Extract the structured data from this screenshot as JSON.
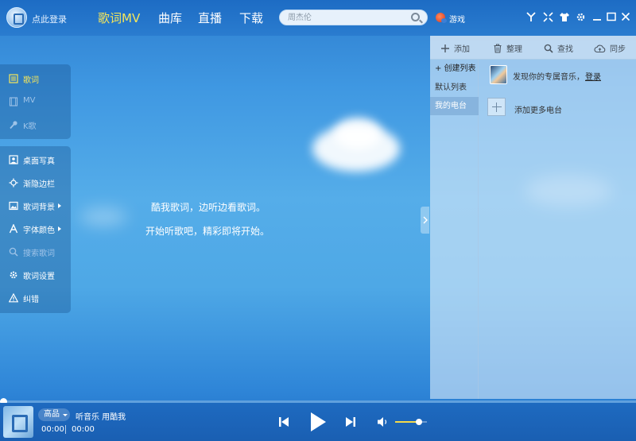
{
  "header": {
    "login": "点此登录",
    "tabs": [
      {
        "label": "歌词MV",
        "active": true
      },
      {
        "label": "曲库",
        "active": false
      },
      {
        "label": "直播",
        "active": false
      },
      {
        "label": "下载",
        "active": false
      }
    ],
    "search_placeholder": "周杰伦",
    "game_label": "游戏",
    "window_controls": [
      "antenna-icon",
      "compact-mode-icon",
      "skin-shirt-icon",
      "settings-gear-icon",
      "minimize-icon",
      "maximize-icon",
      "close-icon"
    ]
  },
  "side_menu_top": [
    {
      "label": "歌词",
      "icon": "lyrics-icon",
      "state": "active"
    },
    {
      "label": "MV",
      "icon": "mv-film-icon",
      "state": "disabled"
    },
    {
      "label": "K歌",
      "icon": "microphone-icon",
      "state": "disabled"
    }
  ],
  "side_menu_bottom": [
    {
      "label": "桌面写真",
      "icon": "desktop-photo-icon",
      "state": "normal",
      "submenu": false
    },
    {
      "label": "渐隐边栏",
      "icon": "fade-sidebar-icon",
      "state": "normal",
      "submenu": false
    },
    {
      "label": "歌词背景",
      "icon": "image-icon",
      "state": "normal",
      "submenu": true
    },
    {
      "label": "字体颜色",
      "icon": "font-icon",
      "state": "normal",
      "submenu": true
    },
    {
      "label": "搜索歌词",
      "icon": "search-icon",
      "state": "disabled",
      "submenu": false
    },
    {
      "label": "歌词设置",
      "icon": "gear-icon",
      "state": "normal",
      "submenu": false
    },
    {
      "label": "纠错",
      "icon": "warning-icon",
      "state": "normal",
      "submenu": false
    }
  ],
  "center": {
    "line1": "酷我歌词，边听边看歌词。",
    "line2": "开始听歌吧，精彩即将开始。"
  },
  "right_panel": {
    "toolbar": [
      {
        "label": "添加",
        "icon": "plus-icon"
      },
      {
        "label": "整理",
        "icon": "trash-icon"
      },
      {
        "label": "查找",
        "icon": "search-icon"
      },
      {
        "label": "同步",
        "icon": "cloud-sync-icon"
      }
    ],
    "lists": [
      {
        "label": "+ 创建列表",
        "kind": "create"
      },
      {
        "label": "默认列表",
        "kind": "normal"
      },
      {
        "label": "我的电台",
        "kind": "active"
      }
    ],
    "discover_text": "发现你的专属音乐，",
    "discover_login": "登录",
    "add_radio": "添加更多电台"
  },
  "player": {
    "quality": "高品",
    "title": "听音乐 用酷我",
    "time_current": "00:00",
    "time_total": "00:00",
    "volume": 0.75,
    "progress": 0,
    "accent": "#f5d94a"
  }
}
